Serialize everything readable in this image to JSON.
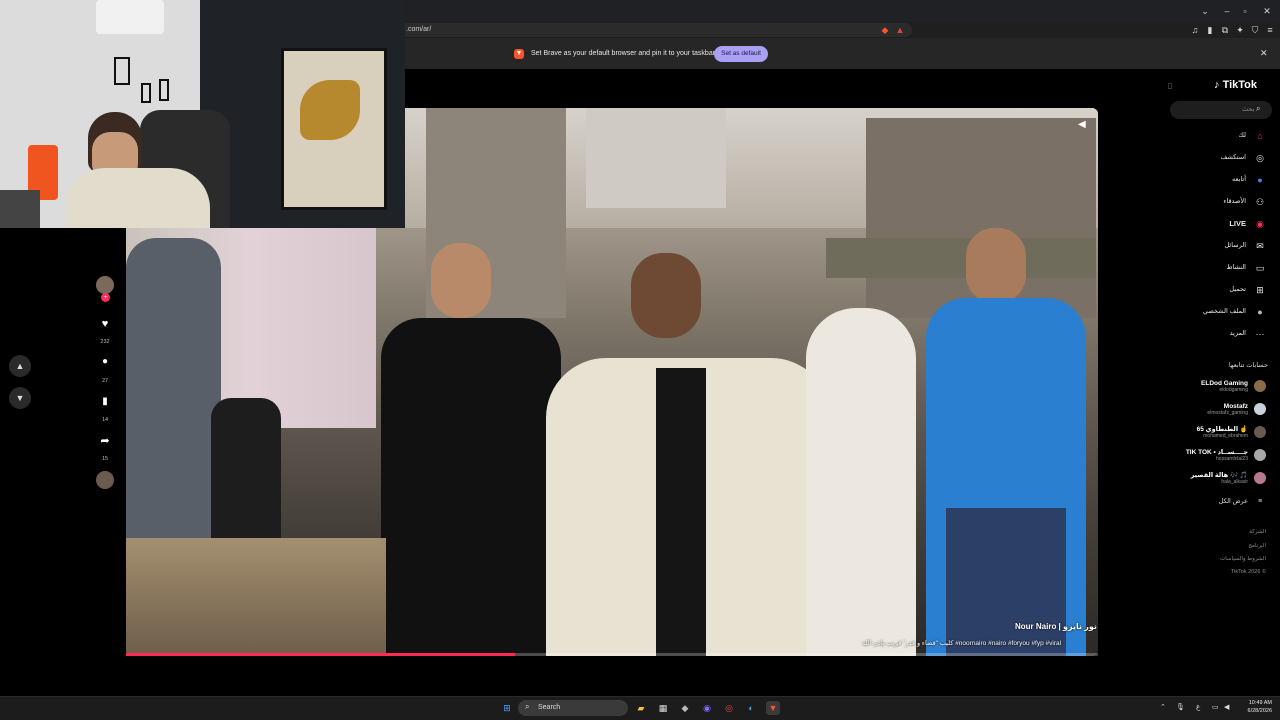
{
  "browser": {
    "url": ".com/ar/",
    "infobar_text": "Set Brave as your default browser and pin it to your taskbar",
    "set_default_label": "Set as default",
    "close_label": "✕"
  },
  "tiktok": {
    "logo": "TikTok",
    "search_placeholder": "بحث",
    "nav": [
      {
        "label": "لك",
        "icon": "home-icon",
        "glyph": "⌂",
        "color": "#fe2c55"
      },
      {
        "label": "استكشف",
        "icon": "compass-icon",
        "glyph": "◎",
        "color": "#e8e8e8"
      },
      {
        "label": "أتابعه",
        "icon": "following-avatar-icon",
        "glyph": "●",
        "color": "#5a7bd6"
      },
      {
        "label": "الأصدقاء",
        "icon": "friends-icon",
        "glyph": "⚇",
        "color": "#e8e8e8"
      },
      {
        "label": "LIVE",
        "icon": "live-icon",
        "glyph": "◉",
        "color": "#fe2c55"
      },
      {
        "label": "الرسائل",
        "icon": "messages-icon",
        "glyph": "✉",
        "color": "#e8e8e8"
      },
      {
        "label": "النشاط",
        "icon": "activity-icon",
        "glyph": "▭",
        "color": "#e8e8e8"
      },
      {
        "label": "تحميل",
        "icon": "upload-icon",
        "glyph": "⊞",
        "color": "#e8e8e8"
      },
      {
        "label": "الملف الشخصي",
        "icon": "profile-avatar-icon",
        "glyph": "●",
        "color": "#bbbbbb"
      },
      {
        "label": "المزيد",
        "icon": "more-icon",
        "glyph": "···",
        "color": "#e8e8e8"
      }
    ],
    "following_title": "حسابات تتابعها",
    "following": [
      {
        "name": "ELDod Gaming",
        "handle": "eldodgaming",
        "color": "#8a6b4a"
      },
      {
        "name": "Mostafz",
        "handle": "elmostafz_gaming",
        "color": "#c9d2dc"
      },
      {
        "name": "الطنطاوي 65 ☝️",
        "handle": "mohamed_ebrahem",
        "color": "#6b5a4e"
      },
      {
        "name": "TIK TOK • جــــســاد",
        "handle": "hossamhilal23",
        "color": "#a8a8a8"
      },
      {
        "name": "هالة القصير 🎶 🎵",
        "handle": "hala_alkasir",
        "color": "#b87a8a"
      }
    ],
    "see_more": "عرض الكل",
    "footer": [
      "الشركة",
      "البرنامج",
      "الشروط والسياسات",
      "TikTok 2026 ©"
    ]
  },
  "video": {
    "creator": "Nour Nairo | نور نايرو",
    "caption": "كليب \"قضاء و قدر\" قريب بإذن الله #noornairo #nairo #foryou #fyp #viral",
    "progress": 0.4,
    "likes": "232",
    "comments": "27",
    "saves": "14",
    "shares": "15"
  },
  "taskbar": {
    "search_label": "Search",
    "time": "10:49 AM",
    "date": "6/28/2026",
    "lang": "ع"
  }
}
